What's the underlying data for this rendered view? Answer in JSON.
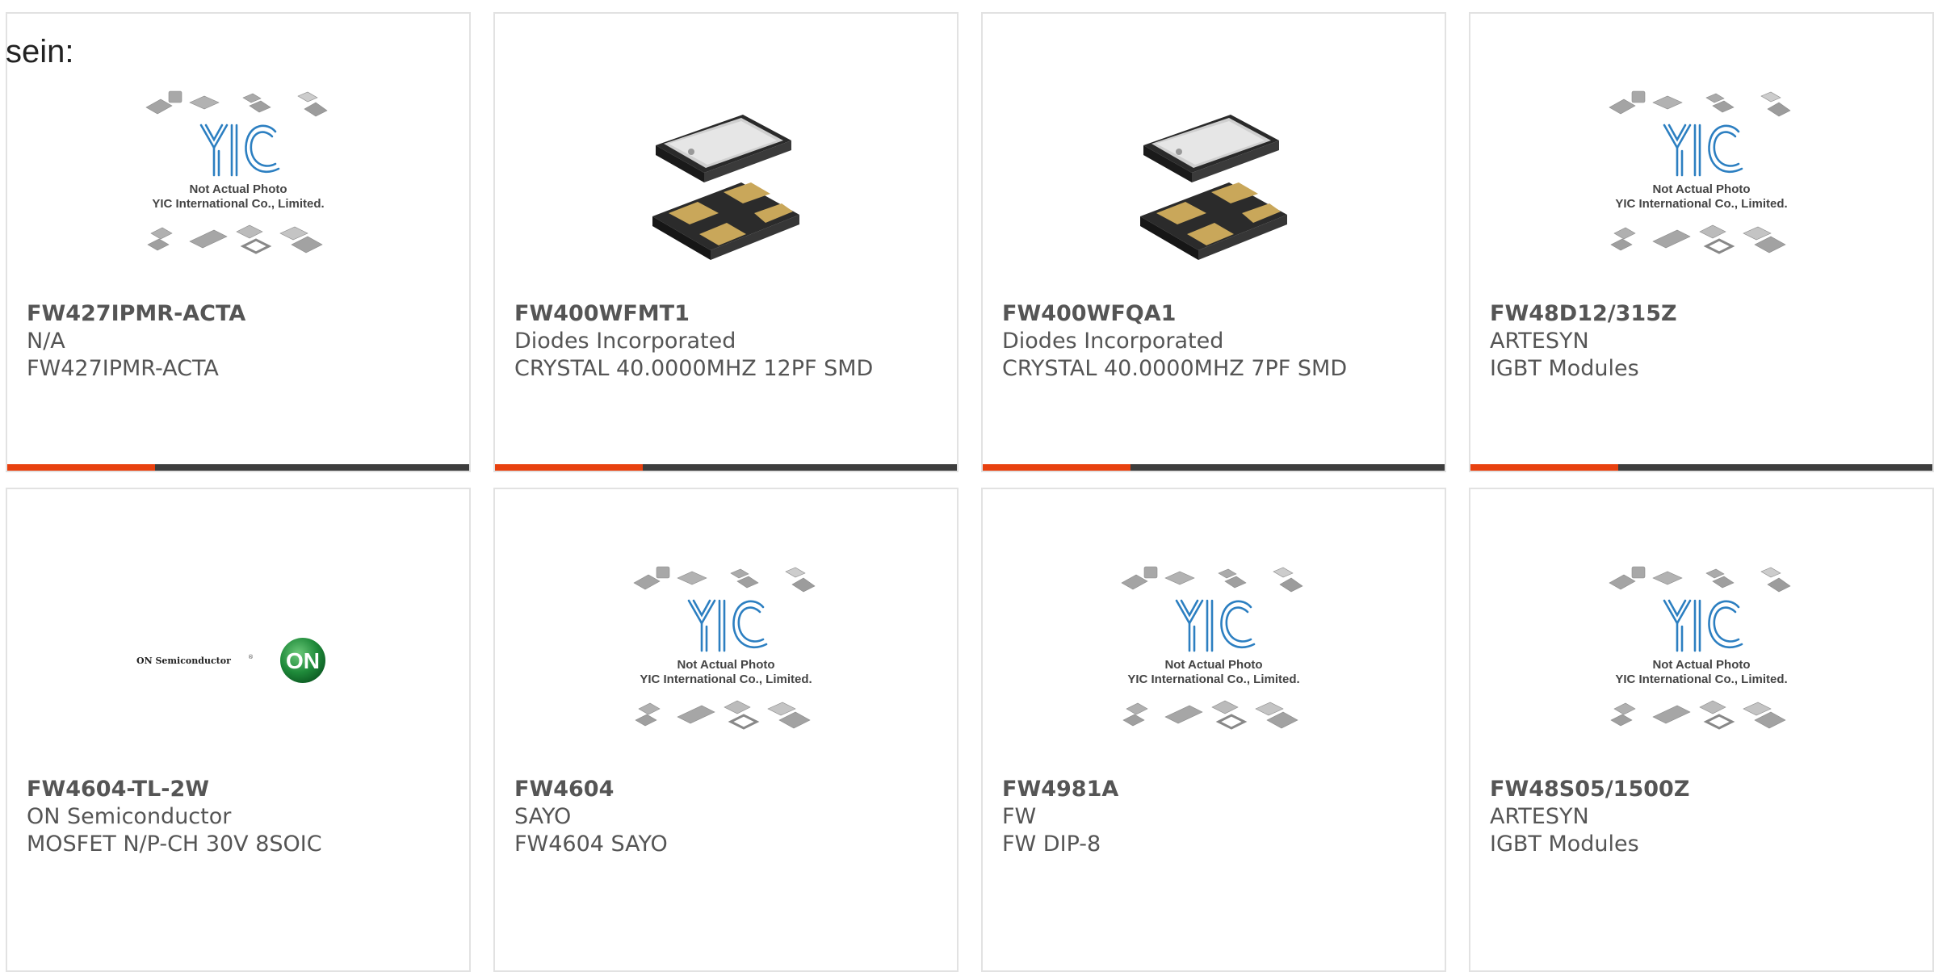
{
  "intro_text": "sein:",
  "colors": {
    "accent": "#e8410f",
    "bar": "#3d3d3d",
    "border": "#e2e2e2",
    "yic_blue": "#2c7fc1",
    "on_green": "#1f8a3a"
  },
  "products": [
    {
      "part": "FW427IPMR-ACTA",
      "manufacturer": "N/A",
      "description": "FW427IPMR-ACTA",
      "image": "yic-placeholder",
      "placeholder_line1": "Not Actual Photo",
      "placeholder_line2": "YIC International Co., Limited."
    },
    {
      "part": "FW400WFMT1",
      "manufacturer": "Diodes Incorporated",
      "description": "CRYSTAL 40.0000MHZ 12PF SMD",
      "image": "crystal-smd"
    },
    {
      "part": "FW400WFQA1",
      "manufacturer": "Diodes Incorporated",
      "description": "CRYSTAL 40.0000MHZ 7PF SMD",
      "image": "crystal-smd"
    },
    {
      "part": "FW48D12/315Z",
      "manufacturer": "ARTESYN",
      "description": "IGBT Modules",
      "image": "yic-placeholder",
      "placeholder_line1": "Not Actual Photo",
      "placeholder_line2": "YIC International Co., Limited."
    },
    {
      "part": "FW4604-TL-2W",
      "manufacturer": "ON Semiconductor",
      "description": "MOSFET N/P-CH 30V 8SOIC",
      "image": "on-semi-logo",
      "logo_text": "ON Semiconductor",
      "logo_badge": "ON"
    },
    {
      "part": "FW4604",
      "manufacturer": "SAYO",
      "description": "FW4604 SAYO",
      "image": "yic-placeholder",
      "placeholder_line1": "Not Actual Photo",
      "placeholder_line2": "YIC International Co., Limited."
    },
    {
      "part": "FW4981A",
      "manufacturer": "FW",
      "description": "FW DIP-8",
      "image": "yic-placeholder",
      "placeholder_line1": "Not Actual Photo",
      "placeholder_line2": "YIC International Co., Limited."
    },
    {
      "part": "FW48S05/1500Z",
      "manufacturer": "ARTESYN",
      "description": "IGBT Modules",
      "image": "yic-placeholder",
      "placeholder_line1": "Not Actual Photo",
      "placeholder_line2": "YIC International Co., Limited."
    }
  ]
}
